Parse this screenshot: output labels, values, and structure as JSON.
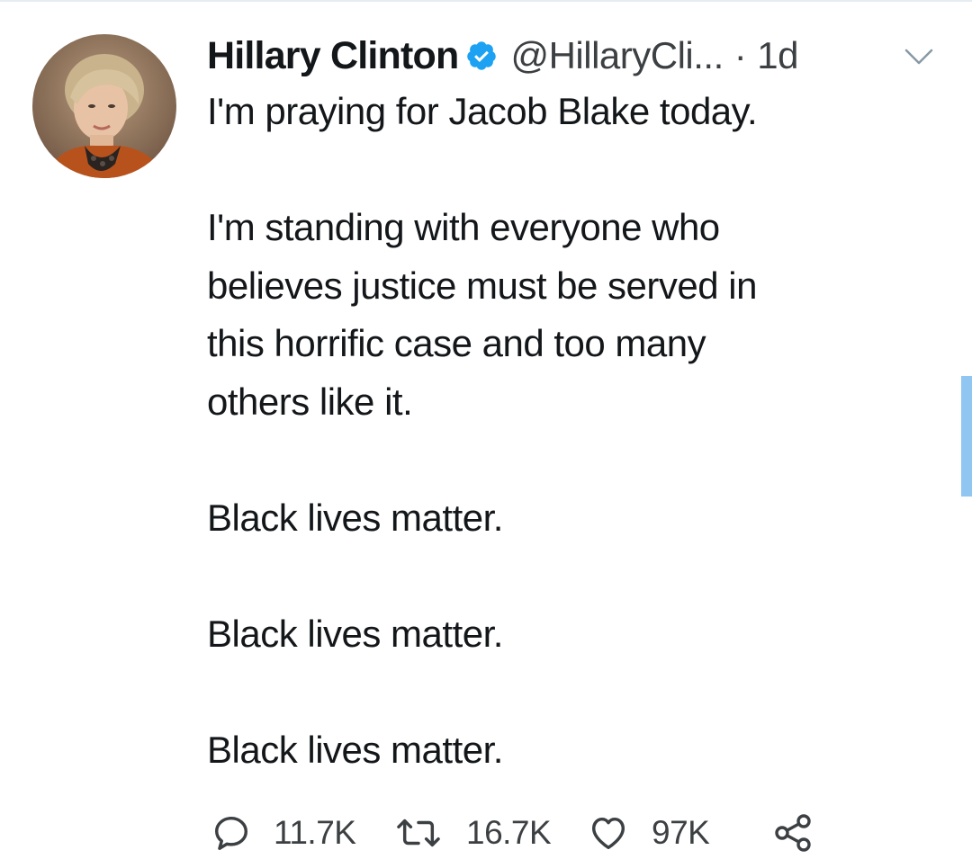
{
  "tweet": {
    "author": {
      "name": "Hillary Clinton",
      "handle": "@HillaryCli...",
      "verified": true,
      "avatar": "profile-photo"
    },
    "separator": "·",
    "time": "1d",
    "lines": [
      "I'm praying for Jacob Blake today.",
      "",
      "I'm standing with everyone who",
      "believes justice must be served in",
      "this horrific case and too many",
      "others like it.",
      "",
      "Black lives matter.",
      "",
      "Black lives matter.",
      "",
      "Black lives matter."
    ],
    "actions": {
      "reply": {
        "icon": "reply-icon",
        "count": "11.7K"
      },
      "retweet": {
        "icon": "retweet-icon",
        "count": "16.7K"
      },
      "like": {
        "icon": "heart-icon",
        "count": "97K"
      },
      "share": {
        "icon": "share-icon"
      }
    }
  },
  "colors": {
    "text": "#14171a",
    "secondary": "#3c4043",
    "verified": "#1da1f2",
    "scroll_indicator": "#8fc7f2"
  }
}
